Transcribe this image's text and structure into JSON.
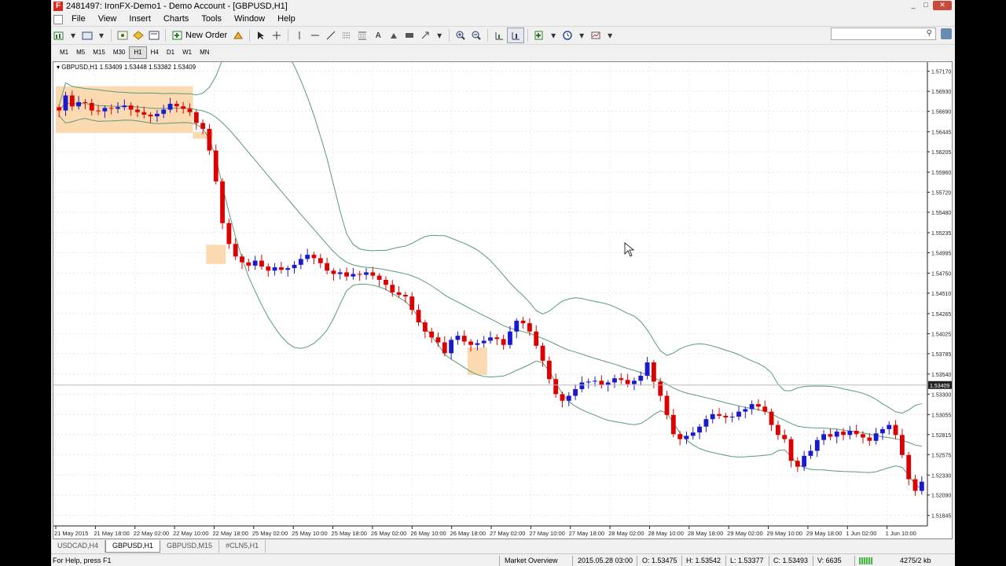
{
  "window": {
    "title": "2481497: IronFX-Demo1 - Demo Account - [GBPUSD,H1]",
    "minimize": "_",
    "maximize": "□",
    "close": "✕"
  },
  "menu": [
    "File",
    "View",
    "Insert",
    "Charts",
    "Tools",
    "Window",
    "Help"
  ],
  "toolbar": {
    "new_order_label": "New Order"
  },
  "timeframes": [
    "M1",
    "M5",
    "M15",
    "M30",
    "H1",
    "H4",
    "D1",
    "W1",
    "MN"
  ],
  "active_timeframe": "H1",
  "chart_tabs": [
    "USDCAD,H4",
    "GBPUSD,H1",
    "GBPUSD,M15",
    "#CLN5,H1"
  ],
  "active_chart_tab": "GBPUSD,H1",
  "status": {
    "help": "For Help, press F1",
    "profile": "Market Overview",
    "datetime": "2015.05.28 03:00",
    "open": "O: 1.53475",
    "high": "H: 1.53542",
    "low": "L: 1.53377",
    "close": "C: 1.53493",
    "volume": "V: 6635",
    "traffic": "4275/2 kb"
  },
  "chart_data": {
    "type": "candlestick",
    "symbol": "GBPUSD,H1",
    "info": "GBPUSD,H1  1.53409 1.53448 1.53382 1.53409",
    "current_price": "1.53409",
    "y_range": [
      1.5172,
      1.5728
    ],
    "y_ticks": [
      "1.57170",
      "1.56930",
      "1.56690",
      "1.56445",
      "1.56205",
      "1.55960",
      "1.55720",
      "1.55480",
      "1.55235",
      "1.54995",
      "1.54750",
      "1.54510",
      "1.54265",
      "1.54025",
      "1.53785",
      "1.53540",
      "1.53300",
      "1.53055",
      "1.52815",
      "1.52575",
      "1.52330",
      "1.52090",
      "1.51845"
    ],
    "x_ticks": [
      "21 May 2015",
      "21 May 18:00",
      "22 May 02:00",
      "22 May 10:00",
      "22 May 18:00",
      "25 May 02:00",
      "25 May 10:00",
      "25 May 18:00",
      "26 May 02:00",
      "26 May 10:00",
      "26 May 18:00",
      "27 May 02:00",
      "27 May 10:00",
      "27 May 18:00",
      "28 May 02:00",
      "28 May 10:00",
      "28 May 18:00",
      "29 May 02:00",
      "29 May 10:00",
      "29 May 18:00",
      "1 Jun 02:00",
      "1 Jun 10:00"
    ],
    "bullish_color": "#1a1acc",
    "bearish_color": "#dd0000",
    "band_color": "#5a9a7a",
    "highlight_color": "#fbd5a8",
    "close_path": [
      1.567,
      1.5688,
      1.5675,
      1.568,
      1.5679,
      1.567,
      1.5669,
      1.5673,
      1.5672,
      1.5674,
      1.5676,
      1.5671,
      1.5668,
      1.5665,
      1.5663,
      1.5666,
      1.5671,
      1.5678,
      1.5675,
      1.5672,
      1.5668,
      1.5655,
      1.5648,
      1.5622,
      1.5585,
      1.5535,
      1.551,
      1.5495,
      1.5488,
      1.5484,
      1.549,
      1.5483,
      1.5478,
      1.5482,
      1.5479,
      1.5481,
      1.5485,
      1.5492,
      1.5497,
      1.5493,
      1.5487,
      1.5478,
      1.5474,
      1.5476,
      1.5471,
      1.5474,
      1.5473,
      1.5476,
      1.5472,
      1.5467,
      1.5461,
      1.5452,
      1.5449,
      1.5447,
      1.5431,
      1.5416,
      1.5405,
      1.5398,
      1.5392,
      1.5379,
      1.5395,
      1.54,
      1.5393,
      1.5389,
      1.5391,
      1.5394,
      1.5398,
      1.5396,
      1.5389,
      1.5405,
      1.5418,
      1.5415,
      1.5405,
      1.5388,
      1.537,
      1.5348,
      1.533,
      1.5322,
      1.5328,
      1.5336,
      1.5344,
      1.5345,
      1.5346,
      1.5341,
      1.5344,
      1.5349,
      1.5347,
      1.5342,
      1.5346,
      1.5352,
      1.5368,
      1.5345,
      1.5328,
      1.5305,
      1.5282,
      1.5276,
      1.528,
      1.5284,
      1.5291,
      1.53,
      1.5306,
      1.5304,
      1.5302,
      1.5303,
      1.5309,
      1.5312,
      1.5318,
      1.5315,
      1.5309,
      1.5293,
      1.5281,
      1.5276,
      1.525,
      1.5243,
      1.5256,
      1.5262,
      1.5275,
      1.5282,
      1.5279,
      1.5285,
      1.5281,
      1.5286,
      1.5282,
      1.5278,
      1.5274,
      1.5283,
      1.5288,
      1.5293,
      1.5281,
      1.5257,
      1.5228,
      1.5214,
      1.5225
    ]
  }
}
